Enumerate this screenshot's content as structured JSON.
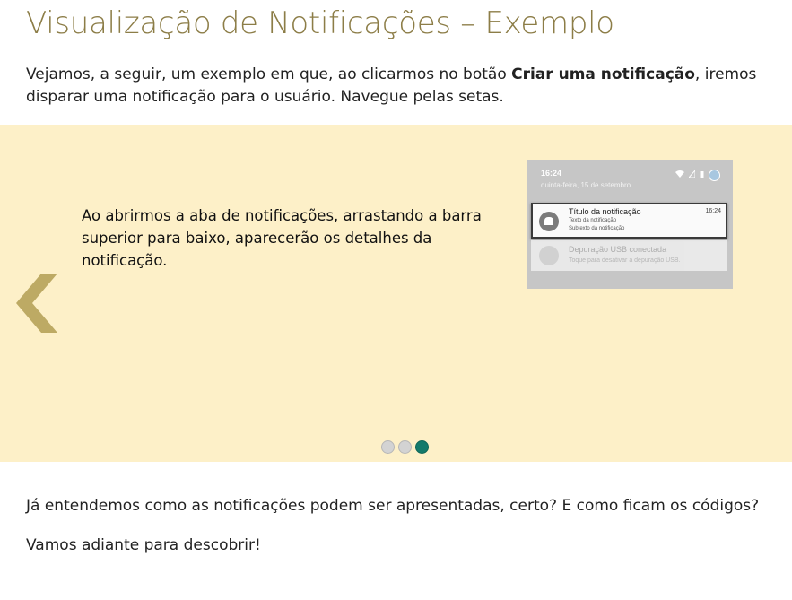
{
  "page": {
    "title": "Visualização de Notificações – Exemplo",
    "intro_before": "Vejamos, a seguir, um exemplo em que, ao clicarmos no botão ",
    "intro_bold": "Criar uma notificação",
    "intro_after": ", iremos disparar uma notificação para o usuário. Navegue pelas setas."
  },
  "carousel": {
    "background": "#fdf0c8",
    "arrow_color": "#bdaa64",
    "slide_text": "Ao abrirmos a aba de notificações, arrastando a barra superior para baixo, aparecerão os detalhes da notificação.",
    "active_dot": 3,
    "dot_count": 3
  },
  "phone": {
    "time": "16:24",
    "date": "quinta-feira, 15 de setembro",
    "status_icons": [
      "wifi-icon",
      "signal-icon",
      "battery-icon",
      "avatar-icon"
    ],
    "notification": {
      "title": "Título da notificação",
      "text": "Texto da notificação",
      "subtext": "Subtexto da notificação",
      "time": "16:24"
    },
    "usb": {
      "title": "Depuração USB conectada",
      "subtitle": "Toque para desativar a depuração USB."
    }
  },
  "outro": {
    "line1": "Já entendemos como as notificações podem ser apresentadas, certo? E como ficam os códigos?",
    "line2": "Vamos adiante para descobrir!"
  },
  "colors": {
    "title": "#8c7d47",
    "dot_active": "#137a6b",
    "dot_inactive": "#d3d3d3"
  }
}
